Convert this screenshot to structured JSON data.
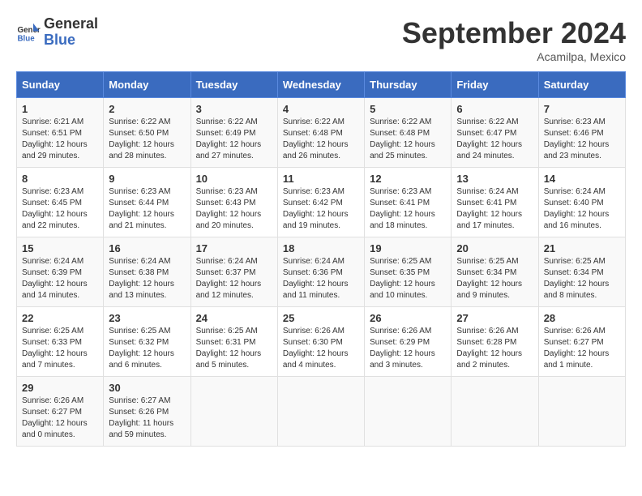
{
  "header": {
    "logo_line1": "General",
    "logo_line2": "Blue",
    "month_title": "September 2024",
    "location": "Acamilpa, Mexico"
  },
  "days_of_week": [
    "Sunday",
    "Monday",
    "Tuesday",
    "Wednesday",
    "Thursday",
    "Friday",
    "Saturday"
  ],
  "weeks": [
    [
      {
        "day": "1",
        "info": "Sunrise: 6:21 AM\nSunset: 6:51 PM\nDaylight: 12 hours\nand 29 minutes."
      },
      {
        "day": "2",
        "info": "Sunrise: 6:22 AM\nSunset: 6:50 PM\nDaylight: 12 hours\nand 28 minutes."
      },
      {
        "day": "3",
        "info": "Sunrise: 6:22 AM\nSunset: 6:49 PM\nDaylight: 12 hours\nand 27 minutes."
      },
      {
        "day": "4",
        "info": "Sunrise: 6:22 AM\nSunset: 6:48 PM\nDaylight: 12 hours\nand 26 minutes."
      },
      {
        "day": "5",
        "info": "Sunrise: 6:22 AM\nSunset: 6:48 PM\nDaylight: 12 hours\nand 25 minutes."
      },
      {
        "day": "6",
        "info": "Sunrise: 6:22 AM\nSunset: 6:47 PM\nDaylight: 12 hours\nand 24 minutes."
      },
      {
        "day": "7",
        "info": "Sunrise: 6:23 AM\nSunset: 6:46 PM\nDaylight: 12 hours\nand 23 minutes."
      }
    ],
    [
      {
        "day": "8",
        "info": "Sunrise: 6:23 AM\nSunset: 6:45 PM\nDaylight: 12 hours\nand 22 minutes."
      },
      {
        "day": "9",
        "info": "Sunrise: 6:23 AM\nSunset: 6:44 PM\nDaylight: 12 hours\nand 21 minutes."
      },
      {
        "day": "10",
        "info": "Sunrise: 6:23 AM\nSunset: 6:43 PM\nDaylight: 12 hours\nand 20 minutes."
      },
      {
        "day": "11",
        "info": "Sunrise: 6:23 AM\nSunset: 6:42 PM\nDaylight: 12 hours\nand 19 minutes."
      },
      {
        "day": "12",
        "info": "Sunrise: 6:23 AM\nSunset: 6:41 PM\nDaylight: 12 hours\nand 18 minutes."
      },
      {
        "day": "13",
        "info": "Sunrise: 6:24 AM\nSunset: 6:41 PM\nDaylight: 12 hours\nand 17 minutes."
      },
      {
        "day": "14",
        "info": "Sunrise: 6:24 AM\nSunset: 6:40 PM\nDaylight: 12 hours\nand 16 minutes."
      }
    ],
    [
      {
        "day": "15",
        "info": "Sunrise: 6:24 AM\nSunset: 6:39 PM\nDaylight: 12 hours\nand 14 minutes."
      },
      {
        "day": "16",
        "info": "Sunrise: 6:24 AM\nSunset: 6:38 PM\nDaylight: 12 hours\nand 13 minutes."
      },
      {
        "day": "17",
        "info": "Sunrise: 6:24 AM\nSunset: 6:37 PM\nDaylight: 12 hours\nand 12 minutes."
      },
      {
        "day": "18",
        "info": "Sunrise: 6:24 AM\nSunset: 6:36 PM\nDaylight: 12 hours\nand 11 minutes."
      },
      {
        "day": "19",
        "info": "Sunrise: 6:25 AM\nSunset: 6:35 PM\nDaylight: 12 hours\nand 10 minutes."
      },
      {
        "day": "20",
        "info": "Sunrise: 6:25 AM\nSunset: 6:34 PM\nDaylight: 12 hours\nand 9 minutes."
      },
      {
        "day": "21",
        "info": "Sunrise: 6:25 AM\nSunset: 6:34 PM\nDaylight: 12 hours\nand 8 minutes."
      }
    ],
    [
      {
        "day": "22",
        "info": "Sunrise: 6:25 AM\nSunset: 6:33 PM\nDaylight: 12 hours\nand 7 minutes."
      },
      {
        "day": "23",
        "info": "Sunrise: 6:25 AM\nSunset: 6:32 PM\nDaylight: 12 hours\nand 6 minutes."
      },
      {
        "day": "24",
        "info": "Sunrise: 6:25 AM\nSunset: 6:31 PM\nDaylight: 12 hours\nand 5 minutes."
      },
      {
        "day": "25",
        "info": "Sunrise: 6:26 AM\nSunset: 6:30 PM\nDaylight: 12 hours\nand 4 minutes."
      },
      {
        "day": "26",
        "info": "Sunrise: 6:26 AM\nSunset: 6:29 PM\nDaylight: 12 hours\nand 3 minutes."
      },
      {
        "day": "27",
        "info": "Sunrise: 6:26 AM\nSunset: 6:28 PM\nDaylight: 12 hours\nand 2 minutes."
      },
      {
        "day": "28",
        "info": "Sunrise: 6:26 AM\nSunset: 6:27 PM\nDaylight: 12 hours\nand 1 minute."
      }
    ],
    [
      {
        "day": "29",
        "info": "Sunrise: 6:26 AM\nSunset: 6:27 PM\nDaylight: 12 hours\nand 0 minutes."
      },
      {
        "day": "30",
        "info": "Sunrise: 6:27 AM\nSunset: 6:26 PM\nDaylight: 11 hours\nand 59 minutes."
      },
      {
        "day": "",
        "info": ""
      },
      {
        "day": "",
        "info": ""
      },
      {
        "day": "",
        "info": ""
      },
      {
        "day": "",
        "info": ""
      },
      {
        "day": "",
        "info": ""
      }
    ]
  ]
}
